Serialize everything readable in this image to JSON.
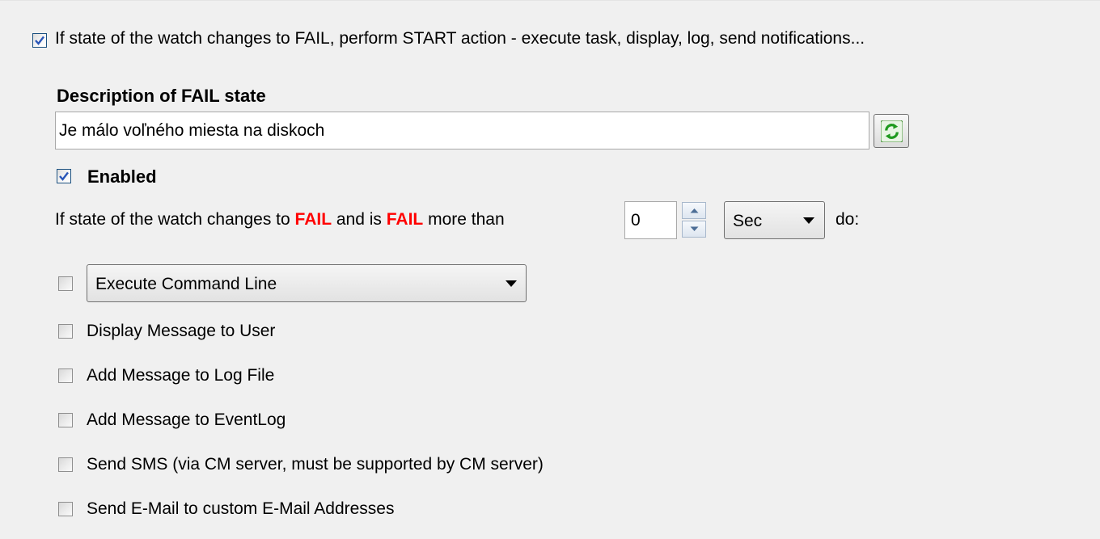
{
  "start_action": {
    "checked": true,
    "label": "If state of the watch changes to FAIL, perform START action - execute task, display, log, send notifications..."
  },
  "description": {
    "title": "Description of FAIL state",
    "value": "Je málo voľného miesta na diskoch",
    "refresh_icon": "refresh-icon"
  },
  "enabled": {
    "checked": true,
    "label": "Enabled"
  },
  "condition": {
    "prefix": "If state of the watch changes to",
    "fail_word": "FAIL",
    "middle": "and is",
    "fail_word_2": "FAIL",
    "suffix": "more than",
    "duration_value": "0",
    "unit_selected": "Sec",
    "do_label": "do:",
    "fail_color": "#ff0000"
  },
  "actions": {
    "execute": {
      "checked": false,
      "selected": "Execute Command Line"
    },
    "display_message": {
      "checked": false,
      "label": "Display Message to User"
    },
    "log_file": {
      "checked": false,
      "label": "Add Message to Log File"
    },
    "event_log": {
      "checked": false,
      "label": "Add Message to EventLog"
    },
    "send_sms": {
      "checked": false,
      "label": "Send SMS (via CM server, must be supported by CM server)"
    },
    "send_email": {
      "checked": false,
      "label": "Send E-Mail to custom E-Mail Addresses"
    }
  }
}
